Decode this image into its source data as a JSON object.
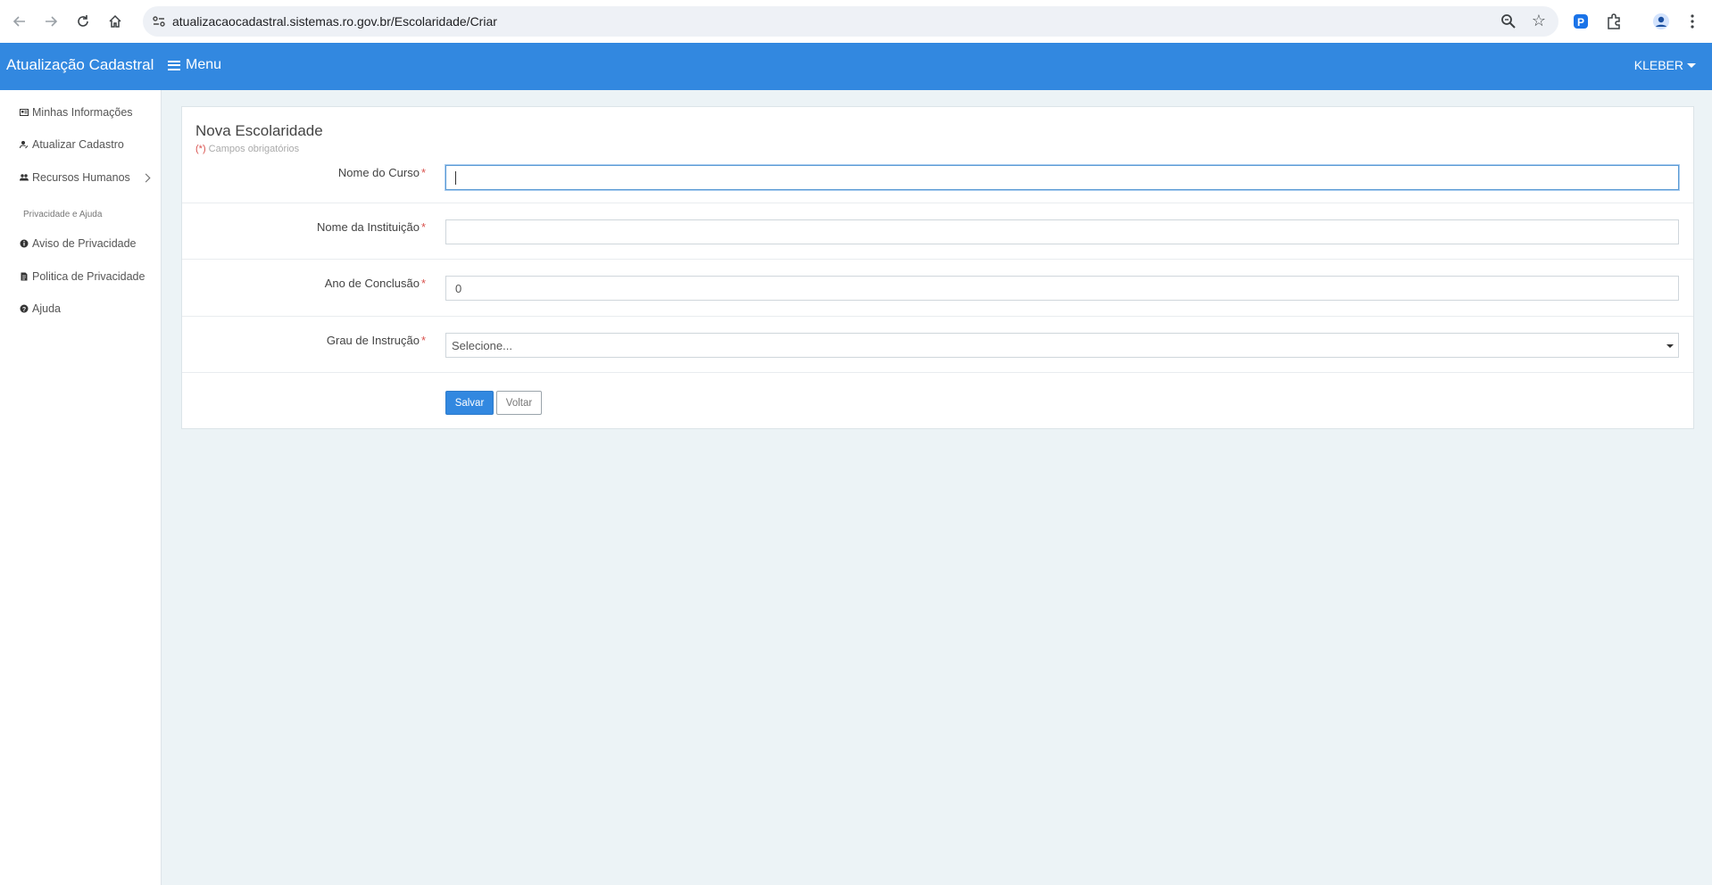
{
  "browser": {
    "url": "atualizacaocadastral.sistemas.ro.gov.br/Escolaridade/Criar"
  },
  "header": {
    "brand": "Atualização Cadastral",
    "menu_label": "Menu",
    "user_label": "KLEBER"
  },
  "sidebar": {
    "items": [
      {
        "label": "Minhas Informações",
        "icon": "id-card-icon"
      },
      {
        "label": "Atualizar Cadastro",
        "icon": "user-edit-icon"
      },
      {
        "label": "Recursos Humanos",
        "icon": "users-icon"
      }
    ],
    "section_heading": "Privacidade e Ajuda",
    "help_items": [
      {
        "label": "Aviso de Privacidade",
        "icon": "info-circle-icon"
      },
      {
        "label": "Politica de Privacidade",
        "icon": "file-icon"
      },
      {
        "label": "Ajuda",
        "icon": "question-circle-icon"
      }
    ]
  },
  "form": {
    "title": "Nova Escolaridade",
    "required_marker": "(*)",
    "required_note": "Campos obrigatórios",
    "fields": [
      {
        "label": "Nome do Curso",
        "value": ""
      },
      {
        "label": "Nome da Instituição",
        "value": ""
      },
      {
        "label": "Ano de Conclusão",
        "value": "0"
      },
      {
        "label": "Grau de Instrução",
        "value": "Selecione..."
      }
    ],
    "required_star": "*",
    "save_label": "Salvar",
    "back_label": "Voltar"
  },
  "colors": {
    "header_bg": "#3288e0",
    "page_bg": "#ecf3f6",
    "required": "#d9534f"
  }
}
